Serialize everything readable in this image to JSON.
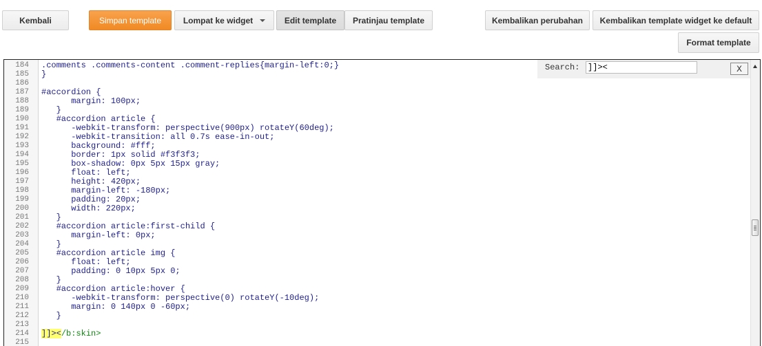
{
  "toolbar": {
    "back_label": "Kembali",
    "save_label": "Simpan template",
    "jump_label": "Lompat ke widget",
    "edit_label": "Edit template",
    "preview_label": "Pratinjau template",
    "revert_label": "Kembalikan perubahan",
    "revert_widgets_label": "Kembalikan template widget ke default",
    "format_label": "Format template"
  },
  "search": {
    "label": "Search:",
    "value": "]]><",
    "close_label": "X"
  },
  "editor": {
    "lines": [
      {
        "n": "184",
        "text": ".comments .comments-content .comment-replies{margin-left:0;}"
      },
      {
        "n": "185",
        "text": "}"
      },
      {
        "n": "186",
        "text": ""
      },
      {
        "n": "187",
        "text": "#accordion {"
      },
      {
        "n": "188",
        "text": "      margin: 100px;"
      },
      {
        "n": "189",
        "text": "   }"
      },
      {
        "n": "190",
        "text": "   #accordion article {"
      },
      {
        "n": "191",
        "text": "      -webkit-transform: perspective(900px) rotateY(60deg);"
      },
      {
        "n": "192",
        "text": "      -webkit-transition: all 0.7s ease-in-out;"
      },
      {
        "n": "193",
        "text": "      background: #fff;"
      },
      {
        "n": "194",
        "text": "      border: 1px solid #f3f3f3;"
      },
      {
        "n": "195",
        "text": "      box-shadow: 0px 5px 15px gray;"
      },
      {
        "n": "196",
        "text": "      float: left;"
      },
      {
        "n": "197",
        "text": "      height: 420px;"
      },
      {
        "n": "198",
        "text": "      margin-left: -180px;"
      },
      {
        "n": "199",
        "text": "      padding: 20px;"
      },
      {
        "n": "200",
        "text": "      width: 220px;"
      },
      {
        "n": "201",
        "text": "   }"
      },
      {
        "n": "202",
        "text": "   #accordion article:first-child {"
      },
      {
        "n": "203",
        "text": "      margin-left: 0px;"
      },
      {
        "n": "204",
        "text": "   }"
      },
      {
        "n": "205",
        "text": "   #accordion article img {"
      },
      {
        "n": "206",
        "text": "      float: left;"
      },
      {
        "n": "207",
        "text": "      padding: 0 10px 5px 0;"
      },
      {
        "n": "208",
        "text": "   }"
      },
      {
        "n": "209",
        "text": "   #accordion article:hover {"
      },
      {
        "n": "210",
        "text": "      -webkit-transform: perspective(0) rotateY(-10deg);"
      },
      {
        "n": "211",
        "text": "      margin: 0 140px 0 -60px;"
      },
      {
        "n": "212",
        "text": "   }"
      },
      {
        "n": "213",
        "text": ""
      },
      {
        "n": "214",
        "text": "]]></b:skin>",
        "highlight": "]]><",
        "rest": "/b:skin>"
      },
      {
        "n": "215",
        "text": ""
      }
    ]
  },
  "colors": {
    "accent": "#f08a24",
    "code_text": "#1e1e8c",
    "tag_text": "#118811",
    "match_highlight": "#ffff70"
  },
  "icons": {
    "close": "close-icon",
    "scroll_up": "arrow-up-icon"
  }
}
